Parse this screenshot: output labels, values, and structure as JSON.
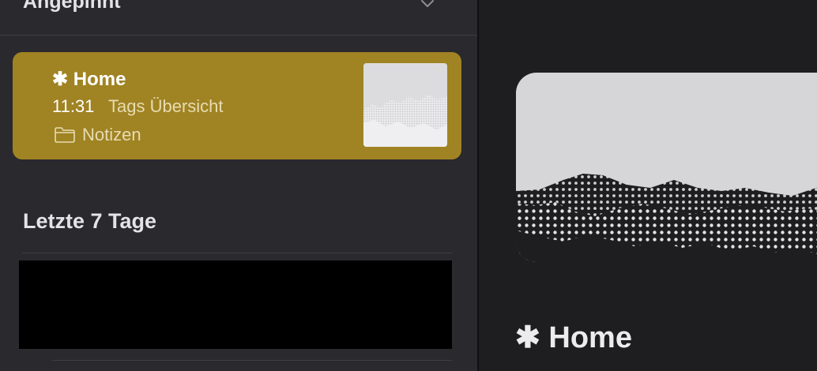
{
  "sidebar": {
    "pinned_header": "Angepinnt",
    "pinned_note": {
      "title": "✱ Home",
      "time": "11:31",
      "preview": "Tags Übersicht",
      "folder": "Notizen"
    },
    "recent_header": "Letzte 7 Tage"
  },
  "editor": {
    "title": "✱ Home"
  },
  "colors": {
    "accent_selected": "#a08323",
    "sidebar_bg": "#29292e",
    "editor_bg": "#1e1e20"
  },
  "icons": {
    "collapse": "chevron-down-icon",
    "folder": "folder-icon"
  }
}
